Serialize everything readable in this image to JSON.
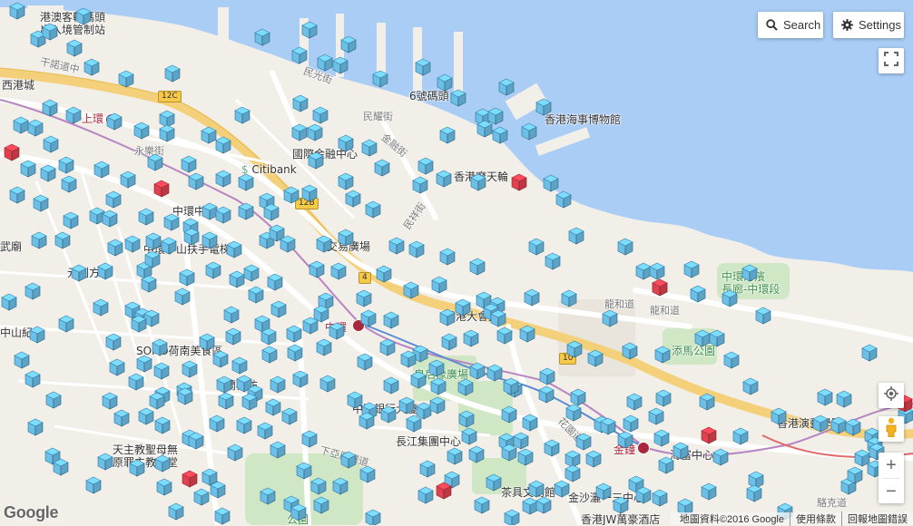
{
  "controls": {
    "search_label": "Search",
    "settings_label": "Settings"
  },
  "attribution": {
    "logo": "Google",
    "map_data": "地圖資料©2016 Google",
    "terms": "使用條款",
    "report": "回報地圖錯誤"
  },
  "labels": {
    "immigration": "港澳客輪碼頭\n出入境管制站",
    "sai_ying_pun": "西港城",
    "connaught": "干諾道中",
    "sheung_wan": "上環",
    "wing_kut": "永樂街",
    "pier6": "6號碼頭",
    "maritime": "香港海事博物館",
    "ifc": "國際金融中心",
    "citibank": "Citibank",
    "ferris": "香港摩天輪",
    "central_ctr": "中環中心",
    "escalator": "中環半山扶手電梯",
    "exchange": "交易廣場",
    "yuen_fong": "元創方",
    "city_hall": "香港大會堂",
    "harbourfront": "中環海濱\n長廊-中環段",
    "lung_wo": "龍和道",
    "tamar": "添馬公園",
    "central": "中環",
    "soho": "SOHO荷南美食區",
    "lan_kwai_fong": "蘭桂坊",
    "statue": "皇后像廣場",
    "boc": "中國銀行大廈",
    "cheung_kong": "長江集團中心",
    "admiralty": "金鐘",
    "admiralty_ctr": "海富中心",
    "academy": "香港演藝學院",
    "cathedral": "天主教聖母無\n原罪主教座堂",
    "tea_ware": "茶具文物館",
    "pacific": "金沙灑一三中心",
    "jw": "香港JW萬豪酒店",
    "zoo_park": "公園",
    "sun_yat_sen": "中山紀念",
    "wu_chung": "武廟",
    "route_4a": "4",
    "route_4b": "4",
    "route_12c": "12C",
    "route_12b": "12B",
    "route_10": "10",
    "queens_rd": "皇后大道中",
    "garden_rd": "花園道",
    "lower_albert": "下亞厘畢道",
    "des_voeux": "德輔道中",
    "man_kwong": "民光街",
    "man_yiu": "民耀街",
    "man_cheung": "民祥街",
    "finance": "金融街",
    "stanley": "士丹利街",
    "lo_fai": "駱克道",
    "arsenal": "軍器廠街",
    "aberdeen": "鴨巴甸街",
    "elgin": "伊利近街"
  },
  "markers": {
    "blue_name": "blue-marker",
    "red_name": "red-marker",
    "blue_color": "#6cc0e8",
    "red_color": "#e0414f"
  }
}
